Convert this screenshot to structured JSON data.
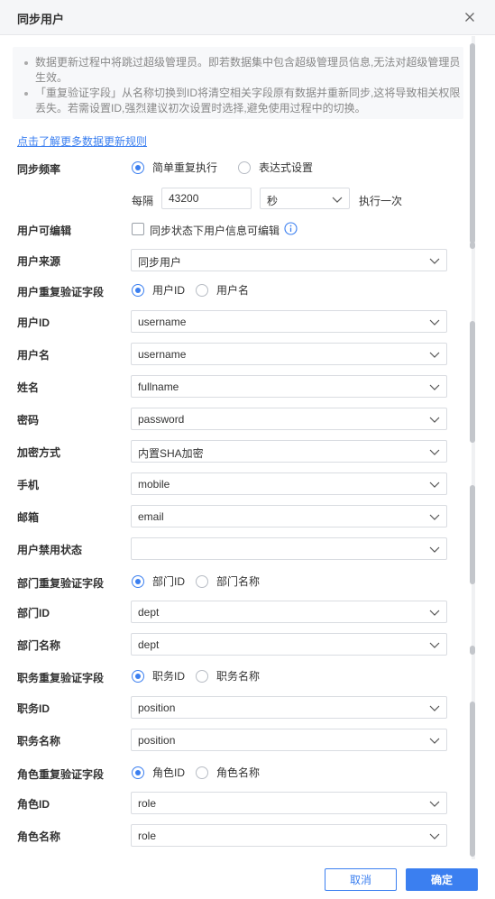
{
  "dialog": {
    "title": "同步用户",
    "close_icon": "close-icon"
  },
  "notice": {
    "items": [
      "数据更新过程中将跳过超级管理员。即若数据集中包含超级管理员信息,无法对超级管理员生效。",
      "「重复验证字段」从名称切换到ID将清空相关字段原有数据并重新同步,这将导致相关权限丢失。若需设置ID,强烈建议初次设置时选择,避免使用过程中的切换。"
    ]
  },
  "learn_more_link": "点击了解更多数据更新规则",
  "sync_frequency": {
    "label": "同步频率",
    "options": [
      "简单重复执行",
      "表达式设置"
    ],
    "selected": "简单重复执行",
    "prefix": "每隔",
    "interval": "43200",
    "unit": "秒",
    "suffix": "执行一次"
  },
  "user_editable": {
    "label": "用户可编辑",
    "checkbox_text": "同步状态下用户信息可编辑",
    "checked": false
  },
  "user_source": {
    "label": "用户来源",
    "value": "同步用户"
  },
  "user_dup_field": {
    "label": "用户重复验证字段",
    "options": [
      "用户ID",
      "用户名"
    ],
    "selected": "用户ID"
  },
  "mappings": [
    {
      "label": "用户ID",
      "value": "username"
    },
    {
      "label": "用户名",
      "value": "username"
    },
    {
      "label": "姓名",
      "value": "fullname"
    },
    {
      "label": "密码",
      "value": "password"
    },
    {
      "label": "加密方式",
      "value": "内置SHA加密"
    },
    {
      "label": "手机",
      "value": "mobile"
    },
    {
      "label": "邮箱",
      "value": "email"
    },
    {
      "label": "用户禁用状态",
      "value": ""
    }
  ],
  "dept_dup_field": {
    "label": "部门重复验证字段",
    "options": [
      "部门ID",
      "部门名称"
    ],
    "selected": "部门ID"
  },
  "dept_mappings": [
    {
      "label": "部门ID",
      "value": "dept"
    },
    {
      "label": "部门名称",
      "value": "dept"
    }
  ],
  "position_dup_field": {
    "label": "职务重复验证字段",
    "options": [
      "职务ID",
      "职务名称"
    ],
    "selected": "职务ID"
  },
  "position_mappings": [
    {
      "label": "职务ID",
      "value": "position"
    },
    {
      "label": "职务名称",
      "value": "position"
    }
  ],
  "role_dup_field": {
    "label": "角色重复验证字段",
    "options": [
      "角色ID",
      "角色名称"
    ],
    "selected": "角色ID"
  },
  "role_mappings": [
    {
      "label": "角色ID",
      "value": "role"
    },
    {
      "label": "角色名称",
      "value": "role"
    }
  ],
  "footer": {
    "cancel": "取消",
    "confirm": "确定"
  },
  "colors": {
    "accent": "#3b7ff0",
    "label": "#333333",
    "notice_text": "#888888"
  }
}
